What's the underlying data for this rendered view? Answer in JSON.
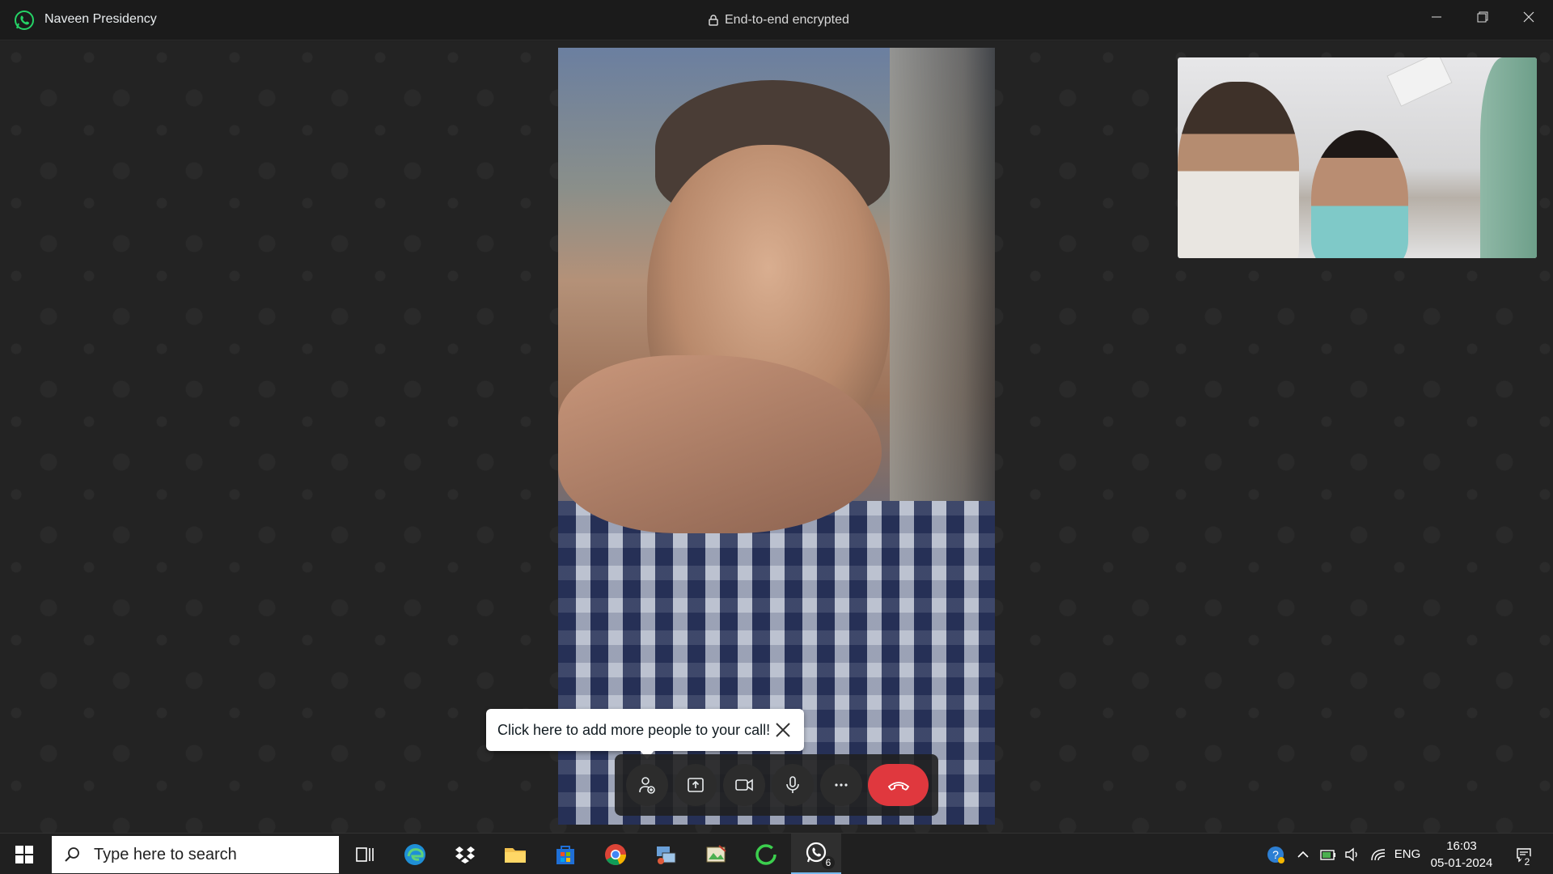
{
  "window": {
    "title": "Naveen Presidency",
    "encryption_label": "End-to-end encrypted"
  },
  "call": {
    "remote_participant_video": "remote-video",
    "self_video": "self-preview"
  },
  "tooltip": {
    "text": "Click here to add more people to your call!"
  },
  "controls": {
    "icons": [
      "add-participant-icon",
      "share-screen-icon",
      "video-camera-icon",
      "microphone-icon",
      "more-options-icon",
      "end-call-icon"
    ]
  },
  "taskbar": {
    "search_placeholder": "Type here to search",
    "whatsapp_badge": "6",
    "language": "ENG",
    "time": "16:03",
    "date": "05-01-2024",
    "notification_count": "2"
  },
  "colors": {
    "accent_end_call": "#e0383e",
    "whatsapp_green": "#25d366",
    "taskbar_bg": "#202020"
  }
}
